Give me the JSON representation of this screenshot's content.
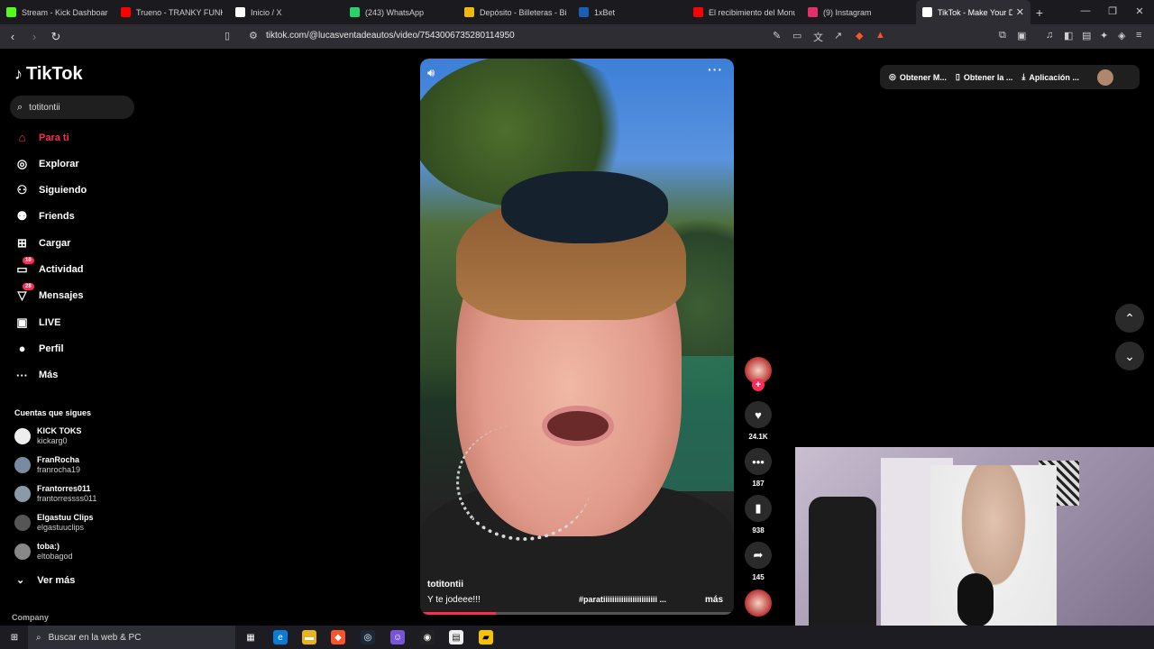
{
  "browser": {
    "tabs": [
      {
        "title": "Stream - Kick Dashboard",
        "icon": "kick-icon",
        "color": "#53fc18"
      },
      {
        "title": "Trueno - TRANKY FUNKY (",
        "icon": "youtube-icon",
        "color": "#ff0000"
      },
      {
        "title": "Inicio / X",
        "icon": "x-icon",
        "color": "#ffffff"
      },
      {
        "title": "(243) WhatsApp",
        "icon": "whatsapp-icon",
        "color": "#25d366"
      },
      {
        "title": "Depósito - Billeteras - Bina",
        "icon": "binance-icon",
        "color": "#f0b90b"
      },
      {
        "title": "1xBet",
        "icon": "1xbet-icon",
        "color": "#1a5fb4"
      },
      {
        "title": "El recibimiento del Monum",
        "icon": "youtube-icon",
        "color": "#ff0000"
      },
      {
        "title": "(9) Instagram",
        "icon": "instagram-icon",
        "color": "#e1306c"
      },
      {
        "title": "TikTok - Make Your Da",
        "icon": "tiktok-icon",
        "color": "#ffffff"
      }
    ],
    "url": "tiktok.com/@lucasventadeautos/video/7543006735280114950"
  },
  "sidebar": {
    "logo": "TikTok",
    "search_value": "totitontii",
    "menu": [
      {
        "label": "Para ti",
        "icon": "home-icon",
        "badge": ""
      },
      {
        "label": "Explorar",
        "icon": "compass-icon",
        "badge": ""
      },
      {
        "label": "Siguiendo",
        "icon": "following-icon",
        "badge": ""
      },
      {
        "label": "Friends",
        "icon": "friends-icon",
        "badge": ""
      },
      {
        "label": "Cargar",
        "icon": "upload-icon",
        "badge": ""
      },
      {
        "label": "Actividad",
        "icon": "activity-icon",
        "badge": "10"
      },
      {
        "label": "Mensajes",
        "icon": "messages-icon",
        "badge": "28"
      },
      {
        "label": "LIVE",
        "icon": "live-icon",
        "badge": ""
      },
      {
        "label": "Perfil",
        "icon": "profile-icon",
        "badge": ""
      },
      {
        "label": "Más",
        "icon": "more-icon",
        "badge": ""
      }
    ],
    "following_title": "Cuentas que sigues",
    "following": [
      {
        "name": "KICK TOKS",
        "handle": "kickarg0"
      },
      {
        "name": "FranRocha",
        "handle": "franrocha19"
      },
      {
        "name": "Frantorres011",
        "handle": "frantorressss011"
      },
      {
        "name": "Elgastuu Clips",
        "handle": "elgastuuclips"
      },
      {
        "name": "toba:)",
        "handle": "eltobagod"
      }
    ],
    "see_more": "Ver más",
    "company": "Company"
  },
  "video": {
    "username": "totitontii",
    "caption": "Y te jodeee!!!",
    "hashtags": "#paratiiiiiiiiiiiiiiiiiiiiiiii ...",
    "more": "más",
    "progress": 0.24
  },
  "actions": {
    "likes": "24.1K",
    "comments": "187",
    "saves": "938",
    "shares": "145"
  },
  "topright": {
    "btn1": "Obtener M...",
    "btn2": "Obtener la ...",
    "btn3": "Aplicación ..."
  },
  "taskbar": {
    "search_placeholder": "Buscar en la web & PC"
  }
}
